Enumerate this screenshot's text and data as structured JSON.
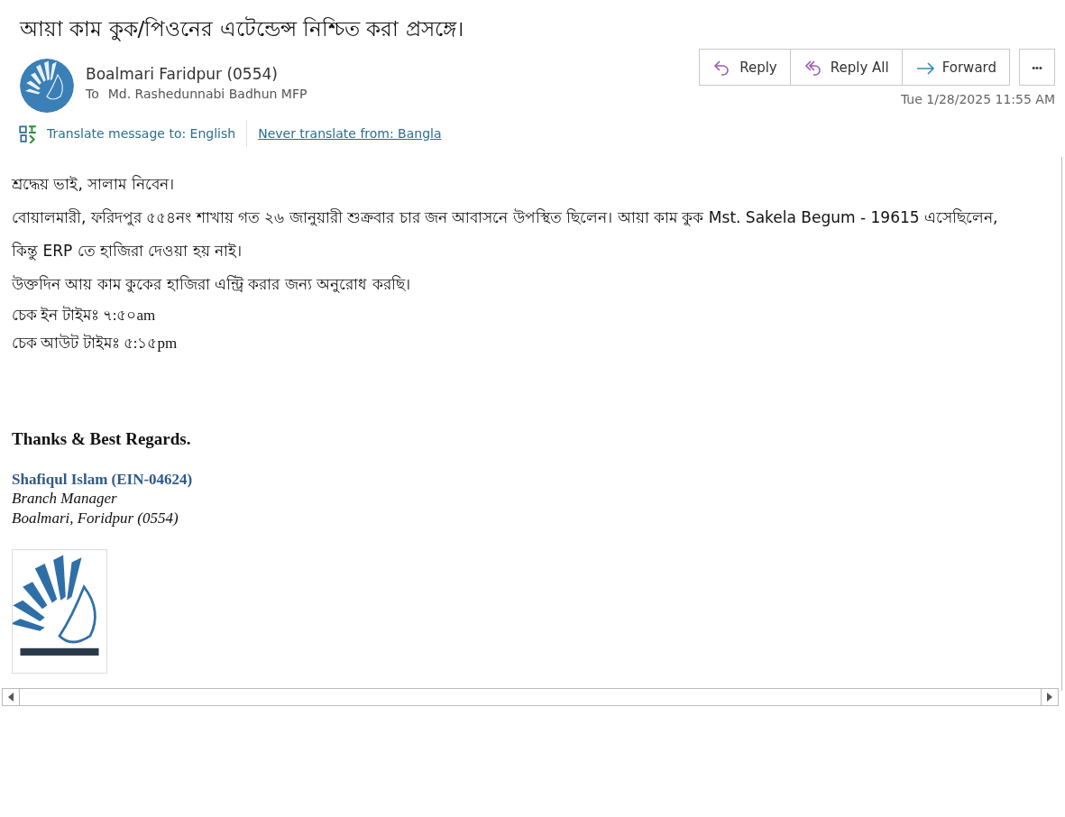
{
  "subject": "আয়া কাম কুক/পিওনের এটেন্ডেন্স নিশ্চিত করা প্রসঙ্গে।",
  "sender": {
    "name": "Boalmari Faridpur (0554)",
    "to_label": "To",
    "to": "Md. Rashedunnabi Badhun MFP"
  },
  "actions": [
    {
      "kind": "reply",
      "label": "Reply"
    },
    {
      "kind": "reply_all",
      "label": "Reply All"
    },
    {
      "kind": "forward",
      "label": "Forward"
    }
  ],
  "more_label": "•••",
  "date": "Tue 1/28/2025 11:55 AM",
  "translate": {
    "action": "Translate message to: English",
    "never": "Never translate from: Bangla"
  },
  "body": [
    {
      "kind": "bn",
      "text": "শ্রদ্ধেয় ভাই, সালাম নিবেন।"
    },
    {
      "kind": "bn",
      "text": "বোয়ালমারী, ফরিদপুর ৫৫৪নং শাখায় গত ২৬ জানুয়ারী শুক্রবার চার জন আবাসনে উপস্থিত ছিলেন। আয়া কাম কুক Mst. Sakela Begum - 19615 এসেছিলেন,"
    },
    {
      "kind": "bn",
      "text": "কিন্তু  ERP তে হাজিরা দেওয়া হয় নাই।"
    },
    {
      "kind": "bn",
      "text": "উক্তদিন আয় কাম কুকের হাজিরা এন্ট্রি করার জন্য অনুরোধ করছি।"
    },
    {
      "kind": "time",
      "text": "চেক ইন টাইমঃ ৭:৫০am"
    },
    {
      "kind": "time",
      "text": "চেক আউট টাইমঃ ৫:১৫pm"
    }
  ],
  "signature": {
    "closing": "Thanks & Best Regards.",
    "name": "Shafiqul Islam (EIN-04624)",
    "title": "Branch Manager",
    "branch": "Boalmari, Foridpur (0554)"
  }
}
